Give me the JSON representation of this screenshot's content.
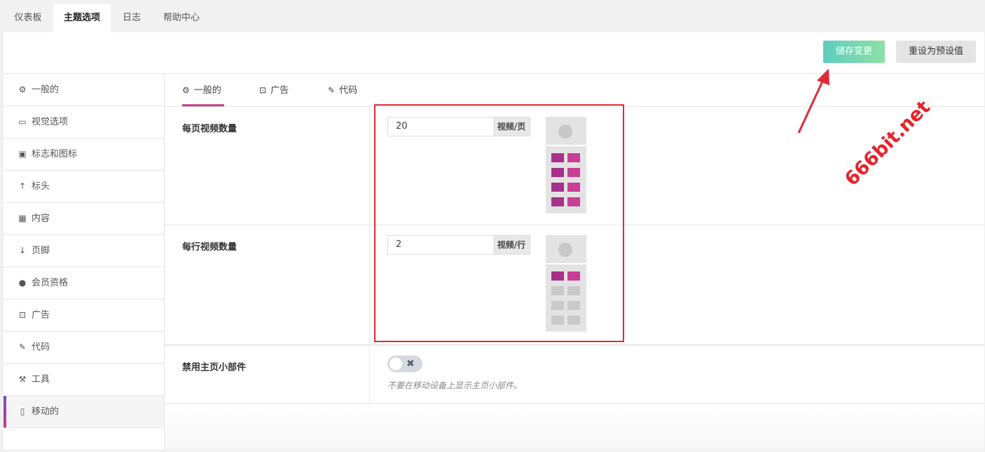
{
  "top_tabs": [
    "仪表板",
    "主题选项",
    "日志",
    "帮助中心"
  ],
  "header": {
    "save_label": "储存变更",
    "reset_label": "重设为预设值"
  },
  "sidebar": {
    "items": [
      {
        "label": "一般的",
        "icon": "gear-icon"
      },
      {
        "label": "视觉选项",
        "icon": "monitor-icon"
      },
      {
        "label": "标志和图标",
        "icon": "image-icon"
      },
      {
        "label": "标头",
        "icon": "arrow-up-icon"
      },
      {
        "label": "内容",
        "icon": "grid-icon"
      },
      {
        "label": "页脚",
        "icon": "arrow-down-icon"
      },
      {
        "label": "会员资格",
        "icon": "user-icon"
      },
      {
        "label": "广告",
        "icon": "money-icon"
      },
      {
        "label": "代码",
        "icon": "pencil-icon"
      },
      {
        "label": "工具",
        "icon": "wrench-icon"
      },
      {
        "label": "移动的",
        "icon": "mobile-icon"
      }
    ],
    "active_index": 10
  },
  "sub_tabs": [
    {
      "label": "一般的",
      "icon": "gear-icon"
    },
    {
      "label": "广告",
      "icon": "money-icon"
    },
    {
      "label": "代码",
      "icon": "pencil-icon"
    }
  ],
  "settings": {
    "videos_per_page": {
      "label": "每页视频数量",
      "value": "20",
      "unit": "视频/页"
    },
    "videos_per_row": {
      "label": "每行视频数量",
      "value": "2",
      "unit": "视频/行"
    },
    "disable_widgets": {
      "label": "禁用主页小部件",
      "toggle": "off",
      "help": "不要在移动设备上显示主页小部件。"
    }
  },
  "watermark": "666bit.net",
  "colors": {
    "accent": "#c13f8e",
    "save_from": "#5ecdbe",
    "save_to": "#8ee0a7",
    "annotation": "#e02a35"
  }
}
